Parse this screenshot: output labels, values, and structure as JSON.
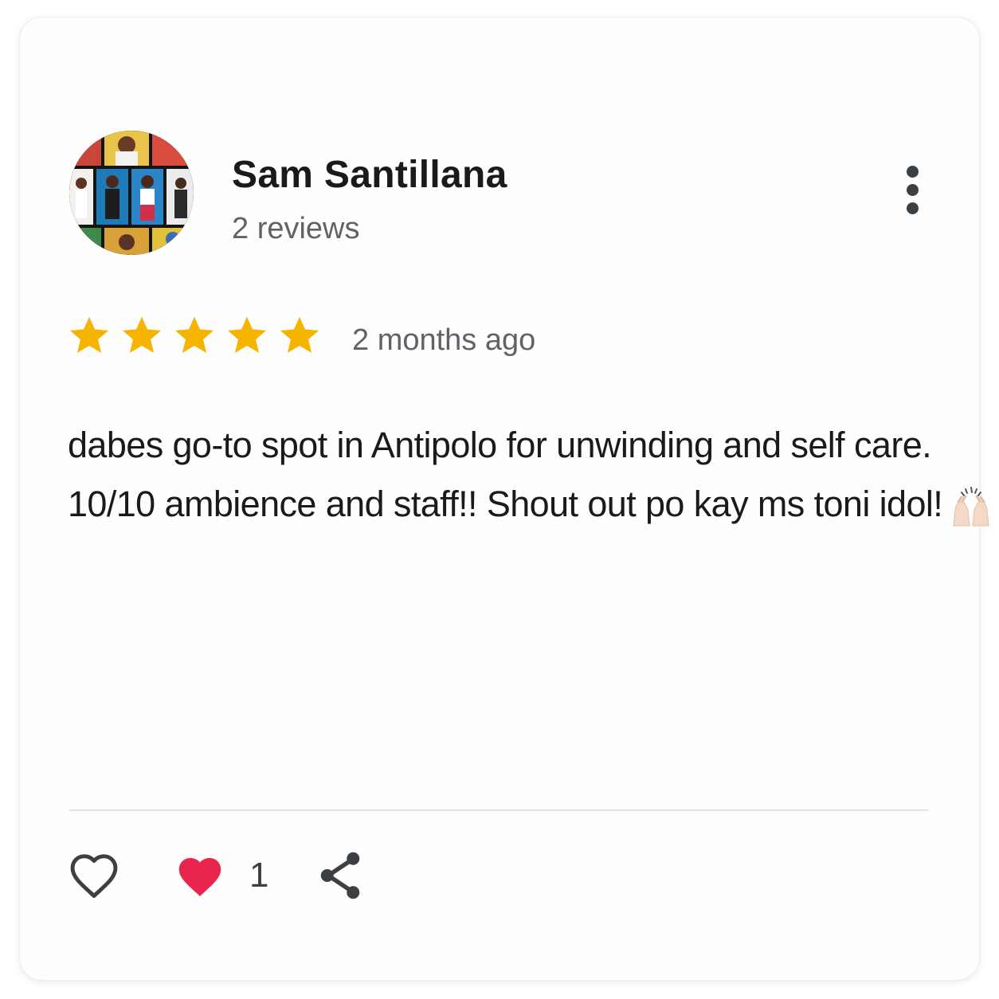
{
  "reviewer": {
    "name": "Sam Santillana",
    "review_count": "2 reviews",
    "avatar_icon": "profile-photo-collage-icon"
  },
  "menu": {
    "icon": "more-vertical-icon"
  },
  "rating": {
    "stars": 5,
    "max_stars": 5,
    "star_color": "#F6B400",
    "time_ago": "2 months ago"
  },
  "review": {
    "line1": "dabes go-to spot in Antipolo for unwinding and self care.",
    "line2": "10/10 ambience and staff!! Shout out po kay ms toni idol!",
    "emoji": "🙌🏻"
  },
  "actions": {
    "like_icon": "heart-outline-icon",
    "love_icon": "heart-filled-icon",
    "love_color": "#E8264D",
    "love_count": "1",
    "share_icon": "share-icon"
  }
}
